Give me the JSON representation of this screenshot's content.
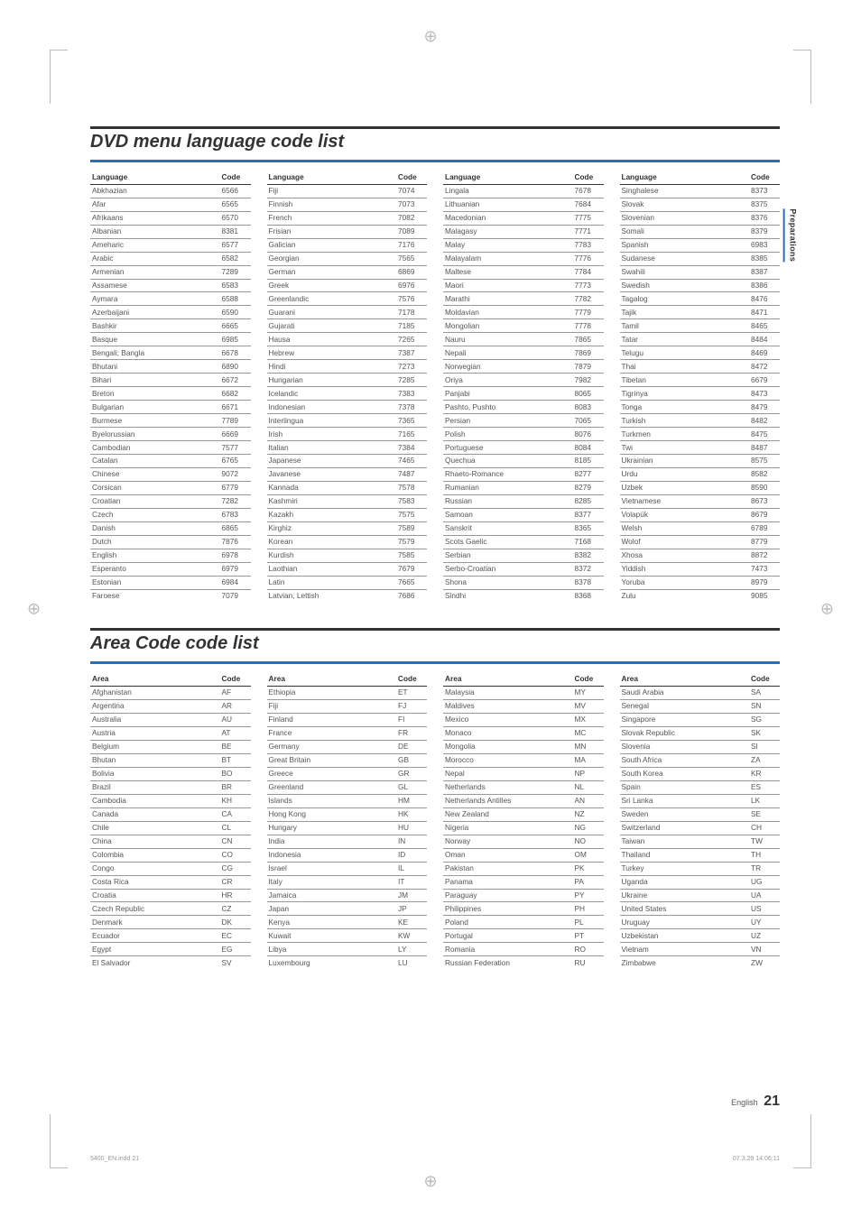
{
  "sideTab": "Preparations",
  "footer": {
    "label": "English",
    "page": "21"
  },
  "printMeta": {
    "file": "5400_EN.indd   21",
    "timestamp": "07.3.29   14:06:11"
  },
  "section1": {
    "title": "DVD menu language code list",
    "headers": [
      "Language",
      "Code"
    ],
    "cols": [
      [
        [
          "Abkhazian",
          "6566"
        ],
        [
          "Afar",
          "6565"
        ],
        [
          "Afrikaans",
          "6570"
        ],
        [
          "Albanian",
          "8381"
        ],
        [
          "Ameharic",
          "6577"
        ],
        [
          "Arabic",
          "6582"
        ],
        [
          "Armenian",
          "7289"
        ],
        [
          "Assamese",
          "6583"
        ],
        [
          "Aymara",
          "6588"
        ],
        [
          "Azerbaijani",
          "6590"
        ],
        [
          "Bashkir",
          "6665"
        ],
        [
          "Basque",
          "6985"
        ],
        [
          "Bengali; Bangla",
          "6678"
        ],
        [
          "Bhutani",
          "6890"
        ],
        [
          "Bihari",
          "6672"
        ],
        [
          "Breton",
          "6682"
        ],
        [
          "Bulgarian",
          "6671"
        ],
        [
          "Burmese",
          "7789"
        ],
        [
          "Byelorussian",
          "6669"
        ],
        [
          "Cambodian",
          "7577"
        ],
        [
          "Catalan",
          "6765"
        ],
        [
          "Chinese",
          "9072"
        ],
        [
          "Corsican",
          "6779"
        ],
        [
          "Croatian",
          "7282"
        ],
        [
          "Czech",
          "6783"
        ],
        [
          "Danish",
          "6865"
        ],
        [
          "Dutch",
          "7876"
        ],
        [
          "English",
          "6978"
        ],
        [
          "Esperanto",
          "6979"
        ],
        [
          "Estonian",
          "6984"
        ],
        [
          "Faroese",
          "7079"
        ]
      ],
      [
        [
          "Fiji",
          "7074"
        ],
        [
          "Finnish",
          "7073"
        ],
        [
          "French",
          "7082"
        ],
        [
          "Frisian",
          "7089"
        ],
        [
          "Galician",
          "7176"
        ],
        [
          "Georgian",
          "7565"
        ],
        [
          "German",
          "6869"
        ],
        [
          "Greek",
          "6976"
        ],
        [
          "Greenlandic",
          "7576"
        ],
        [
          "Guarani",
          "7178"
        ],
        [
          "Gujarati",
          "7185"
        ],
        [
          "Hausa",
          "7265"
        ],
        [
          "Hebrew",
          "7387"
        ],
        [
          "Hindi",
          "7273"
        ],
        [
          "Hungarian",
          "7285"
        ],
        [
          "Icelandic",
          "7383"
        ],
        [
          "Indonesian",
          "7378"
        ],
        [
          "Interlingua",
          "7365"
        ],
        [
          "Irish",
          "7165"
        ],
        [
          "Italian",
          "7384"
        ],
        [
          "Japanese",
          "7465"
        ],
        [
          "Javanese",
          "7487"
        ],
        [
          "Kannada",
          "7578"
        ],
        [
          "Kashmiri",
          "7583"
        ],
        [
          "Kazakh",
          "7575"
        ],
        [
          "Kirghiz",
          "7589"
        ],
        [
          "Korean",
          "7579"
        ],
        [
          "Kurdish",
          "7585"
        ],
        [
          "Laothian",
          "7679"
        ],
        [
          "Latin",
          "7665"
        ],
        [
          "Latvian, Lettish",
          "7686"
        ]
      ],
      [
        [
          "Lingala",
          "7678"
        ],
        [
          "Lithuanian",
          "7684"
        ],
        [
          "Macedonian",
          "7775"
        ],
        [
          "Malagasy",
          "7771"
        ],
        [
          "Malay",
          "7783"
        ],
        [
          "Malayalam",
          "7776"
        ],
        [
          "Maltese",
          "7784"
        ],
        [
          "Maori",
          "7773"
        ],
        [
          "Marathi",
          "7782"
        ],
        [
          "Moldavian",
          "7779"
        ],
        [
          "Mongolian",
          "7778"
        ],
        [
          "Nauru",
          "7865"
        ],
        [
          "Nepali",
          "7869"
        ],
        [
          "Norwegian",
          "7879"
        ],
        [
          "Oriya",
          "7982"
        ],
        [
          "Panjabi",
          "8065"
        ],
        [
          "Pashto, Pushto",
          "8083"
        ],
        [
          "Persian",
          "7065"
        ],
        [
          "Polish",
          "8076"
        ],
        [
          "Portuguese",
          "8084"
        ],
        [
          "Quechua",
          "8185"
        ],
        [
          "Rhaeto-Romance",
          "8277"
        ],
        [
          "Rumanian",
          "8279"
        ],
        [
          "Russian",
          "8285"
        ],
        [
          "Samoan",
          "8377"
        ],
        [
          "Sanskrit",
          "8365"
        ],
        [
          "Scots Gaelic",
          "7168"
        ],
        [
          "Serbian",
          "8382"
        ],
        [
          "Serbo-Croatian",
          "8372"
        ],
        [
          "Shona",
          "8378"
        ],
        [
          "Sindhi",
          "8368"
        ]
      ],
      [
        [
          "Singhalese",
          "8373"
        ],
        [
          "Slovak",
          "8375"
        ],
        [
          "Slovenian",
          "8376"
        ],
        [
          "Somali",
          "8379"
        ],
        [
          "Spanish",
          "6983"
        ],
        [
          "Sudanese",
          "8385"
        ],
        [
          "Swahili",
          "8387"
        ],
        [
          "Swedish",
          "8386"
        ],
        [
          "Tagalog",
          "8476"
        ],
        [
          "Tajik",
          "8471"
        ],
        [
          "Tamil",
          "8465"
        ],
        [
          "Tatar",
          "8484"
        ],
        [
          "Telugu",
          "8469"
        ],
        [
          "Thai",
          "8472"
        ],
        [
          "Tibetan",
          "6679"
        ],
        [
          "Tigrinya",
          "8473"
        ],
        [
          "Tonga",
          "8479"
        ],
        [
          "Turkish",
          "8482"
        ],
        [
          "Turkmen",
          "8475"
        ],
        [
          "Twi",
          "8487"
        ],
        [
          "Ukrainian",
          "8575"
        ],
        [
          "Urdu",
          "8582"
        ],
        [
          "Uzbek",
          "8590"
        ],
        [
          "Vietnamese",
          "8673"
        ],
        [
          "Volapük",
          "8679"
        ],
        [
          "Welsh",
          "6789"
        ],
        [
          "Wolof",
          "8779"
        ],
        [
          "Xhosa",
          "8872"
        ],
        [
          "Yiddish",
          "7473"
        ],
        [
          "Yoruba",
          "8979"
        ],
        [
          "Zulu",
          "9085"
        ]
      ]
    ]
  },
  "section2": {
    "title": "Area Code code list",
    "headers": [
      "Area",
      "Code"
    ],
    "cols": [
      [
        [
          "Afghanistan",
          "AF"
        ],
        [
          "Argentina",
          "AR"
        ],
        [
          "Australia",
          "AU"
        ],
        [
          "Austria",
          "AT"
        ],
        [
          "Belgium",
          "BE"
        ],
        [
          "Bhutan",
          "BT"
        ],
        [
          "Bolivia",
          "BO"
        ],
        [
          "Brazil",
          "BR"
        ],
        [
          "Cambodia",
          "KH"
        ],
        [
          "Canada",
          "CA"
        ],
        [
          "Chile",
          "CL"
        ],
        [
          "China",
          "CN"
        ],
        [
          "Colombia",
          "CO"
        ],
        [
          "Congo",
          "CG"
        ],
        [
          "Costa Rica",
          "CR"
        ],
        [
          "Croatia",
          "HR"
        ],
        [
          "Czech Republic",
          "CZ"
        ],
        [
          "Denmark",
          "DK"
        ],
        [
          "Ecuador",
          "EC"
        ],
        [
          "Egypt",
          "EG"
        ],
        [
          "El Salvador",
          "SV"
        ]
      ],
      [
        [
          "Ethiopia",
          "ET"
        ],
        [
          "Fiji",
          "FJ"
        ],
        [
          "Finland",
          "FI"
        ],
        [
          "France",
          "FR"
        ],
        [
          "Germany",
          "DE"
        ],
        [
          "Great Britain",
          "GB"
        ],
        [
          "Greece",
          "GR"
        ],
        [
          "Greenland",
          "GL"
        ],
        [
          "Islands",
          "HM"
        ],
        [
          "Hong Kong",
          "HK"
        ],
        [
          "Hungary",
          "HU"
        ],
        [
          "India",
          "IN"
        ],
        [
          "Indonesia",
          "ID"
        ],
        [
          "Israel",
          "IL"
        ],
        [
          "Italy",
          "IT"
        ],
        [
          "Jamaica",
          "JM"
        ],
        [
          "Japan",
          "JP"
        ],
        [
          "Kenya",
          "KE"
        ],
        [
          "Kuwait",
          "KW"
        ],
        [
          "Libya",
          "LY"
        ],
        [
          "Luxembourg",
          "LU"
        ]
      ],
      [
        [
          "Malaysia",
          "MY"
        ],
        [
          "Maldives",
          "MV"
        ],
        [
          "Mexico",
          "MX"
        ],
        [
          "Monaco",
          "MC"
        ],
        [
          "Mongolia",
          "MN"
        ],
        [
          "Morocco",
          "MA"
        ],
        [
          "Nepal",
          "NP"
        ],
        [
          "Netherlands",
          "NL"
        ],
        [
          "Netherlands Antilles",
          "AN"
        ],
        [
          "New Zealand",
          "NZ"
        ],
        [
          "Nigeria",
          "NG"
        ],
        [
          "Norway",
          "NO"
        ],
        [
          "Oman",
          "OM"
        ],
        [
          "Pakistan",
          "PK"
        ],
        [
          "Panama",
          "PA"
        ],
        [
          "Paraguay",
          "PY"
        ],
        [
          "Philippines",
          "PH"
        ],
        [
          "Poland",
          "PL"
        ],
        [
          "Portugal",
          "PT"
        ],
        [
          "Romania",
          "RO"
        ],
        [
          "Russian Federation",
          "RU"
        ]
      ],
      [
        [
          "Saudi Arabia",
          "SA"
        ],
        [
          "Senegal",
          "SN"
        ],
        [
          "Singapore",
          "SG"
        ],
        [
          "Slovak Republic",
          "SK"
        ],
        [
          "Slovenia",
          "SI"
        ],
        [
          "South Africa",
          "ZA"
        ],
        [
          "South Korea",
          "KR"
        ],
        [
          "Spain",
          "ES"
        ],
        [
          "Sri Lanka",
          "LK"
        ],
        [
          "Sweden",
          "SE"
        ],
        [
          "Switzerland",
          "CH"
        ],
        [
          "Taiwan",
          "TW"
        ],
        [
          "Thailand",
          "TH"
        ],
        [
          "Turkey",
          "TR"
        ],
        [
          "Uganda",
          "UG"
        ],
        [
          "Ukraine",
          "UA"
        ],
        [
          "United States",
          "US"
        ],
        [
          "Uruguay",
          "UY"
        ],
        [
          "Uzbekistan",
          "UZ"
        ],
        [
          "Vietnam",
          "VN"
        ],
        [
          "Zimbabwe",
          "ZW"
        ]
      ]
    ]
  }
}
